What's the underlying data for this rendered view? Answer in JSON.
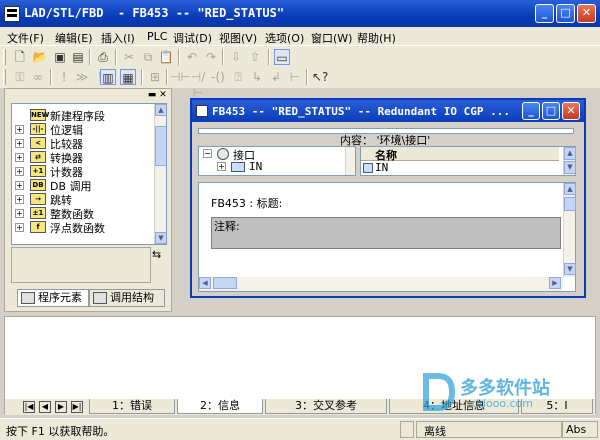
{
  "window": {
    "title": "LAD/STL/FBD  - FB453 -- \"RED_STATUS\""
  },
  "menu": [
    "文件(F)",
    "编辑(E)",
    "插入(I)",
    "PLC",
    "调试(D)",
    "视图(V)",
    "选项(O)",
    "窗口(W)",
    "帮助(H)"
  ],
  "left_panel": {
    "tree": [
      {
        "label": "新建程序段",
        "icon": "network-icon",
        "icon_text": "NEW",
        "expandable": false
      },
      {
        "label": "位逻辑",
        "icon": "bit-logic-icon",
        "icon_text": "-||-",
        "expandable": true
      },
      {
        "label": "比较器",
        "icon": "comparator-icon",
        "icon_text": "<",
        "expandable": true
      },
      {
        "label": "转换器",
        "icon": "converter-icon",
        "icon_text": "⇄",
        "expandable": true
      },
      {
        "label": "计数器",
        "icon": "counter-icon",
        "icon_text": "+1",
        "expandable": true
      },
      {
        "label": "DB 调用",
        "icon": "db-icon",
        "icon_text": "DB",
        "expandable": true
      },
      {
        "label": "跳转",
        "icon": "jump-icon",
        "icon_text": "→",
        "expandable": true
      },
      {
        "label": "整数函数",
        "icon": "integer-icon",
        "icon_text": "±1",
        "expandable": true
      },
      {
        "label": "浮点数函数",
        "icon": "float-icon",
        "icon_text": "f",
        "expandable": true
      }
    ],
    "tabs": [
      "程序元素",
      "调用结构"
    ]
  },
  "inner_window": {
    "title": "FB453 -- \"RED_STATUS\" -- Redundant IO CGP ...",
    "content_label": "内容： '环境\\接口'",
    "interface_root": "接口",
    "interface_child": "IN",
    "decl_header": "名称",
    "decl_row": "IN",
    "block_title": "FB453 : 标题:",
    "comment_label": "注释:"
  },
  "bottom_panel": {
    "tabs": [
      "1：错误",
      "2：信息",
      "3：交叉参考",
      "4：地址信息",
      "5：I"
    ],
    "active_tab": 1
  },
  "status": {
    "help": "按下 F1 以获取帮助。",
    "mode": "离线",
    "abs": "Abs"
  },
  "watermark": {
    "name": "多多软件站",
    "url": "ddooo.com"
  }
}
